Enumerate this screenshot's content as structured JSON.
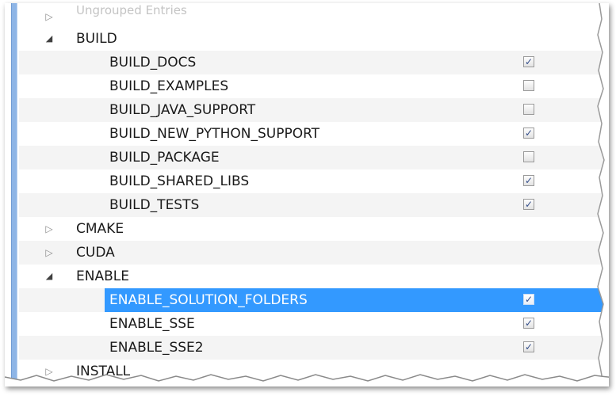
{
  "tree": {
    "partial_top_text": "Ungrouped Entries",
    "rows": [
      {
        "kind": "group",
        "label": "BUILD",
        "expanded": true
      },
      {
        "kind": "child",
        "label": "BUILD_DOCS",
        "checked": true
      },
      {
        "kind": "child",
        "label": "BUILD_EXAMPLES",
        "checked": false
      },
      {
        "kind": "child",
        "label": "BUILD_JAVA_SUPPORT",
        "checked": false
      },
      {
        "kind": "child",
        "label": "BUILD_NEW_PYTHON_SUPPORT",
        "checked": true
      },
      {
        "kind": "child",
        "label": "BUILD_PACKAGE",
        "checked": false
      },
      {
        "kind": "child",
        "label": "BUILD_SHARED_LIBS",
        "checked": true
      },
      {
        "kind": "child",
        "label": "BUILD_TESTS",
        "checked": true
      },
      {
        "kind": "group",
        "label": "CMAKE",
        "expanded": false
      },
      {
        "kind": "group",
        "label": "CUDA",
        "expanded": false
      },
      {
        "kind": "group",
        "label": "ENABLE",
        "expanded": true
      },
      {
        "kind": "child",
        "label": "ENABLE_SOLUTION_FOLDERS",
        "checked": true,
        "selected": true
      },
      {
        "kind": "child",
        "label": "ENABLE_SSE",
        "checked": true
      },
      {
        "kind": "child",
        "label": "ENABLE_SSE2",
        "checked": true
      },
      {
        "kind": "group",
        "label": "INSTALL",
        "expanded": false
      }
    ]
  },
  "icons": {
    "expanded": "triangle-expanded-icon",
    "collapsed": "triangle-collapsed-icon",
    "check": "checkmark-icon"
  },
  "colors": {
    "selection": "#3399ff",
    "left_bar": "#8eb5e6"
  }
}
